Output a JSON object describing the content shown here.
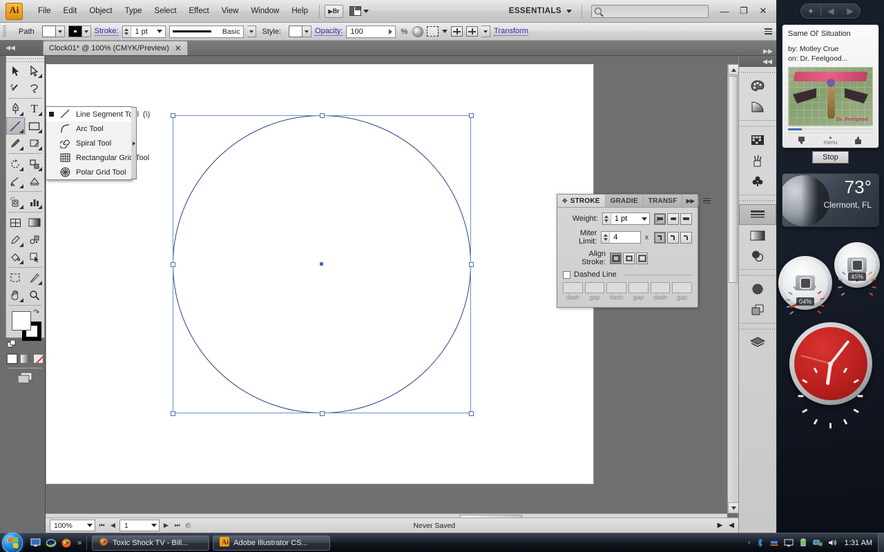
{
  "app": {
    "logo_text": "Ai",
    "menus": [
      "File",
      "Edit",
      "Object",
      "Type",
      "Select",
      "Effect",
      "View",
      "Window",
      "Help"
    ],
    "bridge_label": "Br",
    "workspace": "ESSENTIALS",
    "search_placeholder": "",
    "window_buttons": {
      "minimize": "—",
      "restore": "❐",
      "close": "✕"
    }
  },
  "control_bar": {
    "object_type": "Path",
    "stroke_label": "Stroke:",
    "stroke_weight": "1 pt",
    "profile_name": "Basic",
    "style_label": "Style:",
    "opacity_label": "Opacity:",
    "opacity_value": "100",
    "percent": "%",
    "transform_label": "Transform"
  },
  "document": {
    "tab_title": "Clock01* @ 100% (CMYK/Preview)",
    "tab_close": "✕"
  },
  "status_bar": {
    "zoom": "100%",
    "page": "1",
    "text": "Never Saved"
  },
  "toolbox": {
    "tools": [
      "selection-tool",
      "direct-selection-tool",
      "magic-wand-tool",
      "lasso-tool",
      "pen-tool",
      "type-tool",
      "line-segment-tool",
      "rectangle-tool",
      "paintbrush-tool",
      "pencil-tool",
      "blob-brush-tool",
      "eraser-tool",
      "rotate-tool",
      "scale-tool",
      "warp-tool",
      "free-transform-tool",
      "symbol-sprayer-tool",
      "column-graph-tool",
      "mesh-tool",
      "gradient-tool",
      "eyedropper-tool",
      "blend-tool",
      "live-paint-bucket-tool",
      "live-paint-selection-tool",
      "artboard-tool",
      "slice-tool",
      "hand-tool",
      "zoom-tool"
    ],
    "selected_tool": "line-segment-tool",
    "fill_color": "#ffffff",
    "stroke_color": "#000000"
  },
  "flyout_menu": {
    "items": [
      {
        "label": "Line Segment Tool",
        "shortcut": "(\\)",
        "icon": "line-segment-icon",
        "selected": true
      },
      {
        "label": "Arc Tool",
        "shortcut": "",
        "icon": "arc-icon",
        "selected": false
      },
      {
        "label": "Spiral Tool",
        "shortcut": "",
        "icon": "spiral-icon",
        "selected": false
      },
      {
        "label": "Rectangular Grid Tool",
        "shortcut": "",
        "icon": "rectangular-grid-icon",
        "selected": false
      },
      {
        "label": "Polar Grid Tool",
        "shortcut": "",
        "icon": "polar-grid-icon",
        "selected": false
      }
    ]
  },
  "stroke_panel": {
    "tabs": [
      {
        "label": "STROKE",
        "active": true
      },
      {
        "label": "GRADIE",
        "active": false
      },
      {
        "label": "TRANSF",
        "active": false
      }
    ],
    "weight_label": "Weight:",
    "weight_value": "1 pt",
    "miter_label": "Miter Limit:",
    "miter_value": "4",
    "miter_unit": "x",
    "align_label": "Align Stroke:",
    "dashed_label": "Dashed Line",
    "dash_fields": [
      "",
      "",
      "",
      "",
      "",
      ""
    ],
    "dash_captions": [
      "dash",
      "gap",
      "dash",
      "gap",
      "dash",
      "gap"
    ]
  },
  "right_dock": {
    "items": [
      "color-panel-icon",
      "color-guide-icon",
      "swatches-panel-icon",
      "brushes-panel-icon",
      "symbols-panel-icon",
      "stroke-panel-icon",
      "gradient-panel-icon",
      "transparency-panel-icon",
      "appearance-panel-icon",
      "graphic-styles-panel-icon",
      "layers-panel-icon"
    ],
    "selected": "stroke-panel-icon"
  },
  "sidebar": {
    "add_gadget": "+",
    "prev_arrow": "◀",
    "next_arrow": "▶",
    "music": {
      "title": "Same Ol' Situation",
      "by": "by: Motley Crue",
      "on": "on: Dr. Feelgood...",
      "album_band": "Motley Crue",
      "album_sub": "Dr. Feelgood",
      "thumbs_down": "👎",
      "menu_label": "menu",
      "thumbs_up": "👍",
      "stop_label": "Stop"
    },
    "weather": {
      "temperature": "73°",
      "city": "Clermont, FL"
    },
    "meters": [
      {
        "name": "cpu-meter",
        "value": "04%"
      },
      {
        "name": "memory-meter",
        "value": "45%"
      }
    ],
    "clock": {
      "name": "analog-clock-gadget",
      "color": "#c2201e"
    }
  },
  "taskbar": {
    "start_label": "Start",
    "quick_launch": [
      "show-desktop-icon",
      "internet-explorer-icon",
      "firefox-icon"
    ],
    "overflow": "»",
    "tasks": [
      {
        "label": "Toxic Shock TV - Bill...",
        "icon": "firefox-icon"
      },
      {
        "label": "Adobe Illustrator CS...",
        "icon": "illustrator-icon"
      }
    ],
    "tray_chevron": "‹",
    "tray_icons": [
      "bluetooth-icon",
      "network-drive-icon",
      "display-icon",
      "battery-icon",
      "network-icon",
      "volume-icon"
    ],
    "time": "1:31 AM"
  }
}
